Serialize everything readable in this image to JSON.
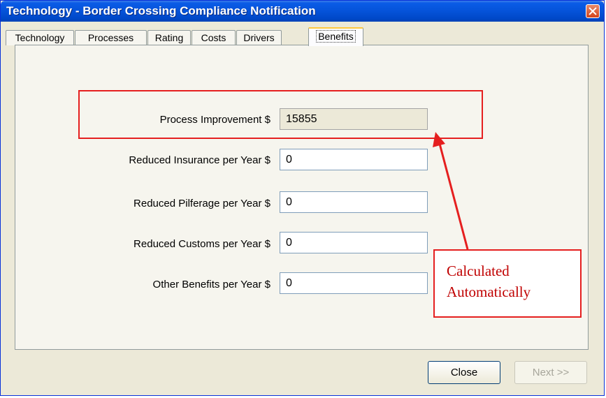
{
  "window": {
    "title": "Technology - Border Crossing Compliance Notification"
  },
  "tabs": [
    "Technology",
    "Processes",
    "Rating",
    "Costs",
    "Drivers",
    "Benefits"
  ],
  "active_tab": "Benefits",
  "fields": {
    "process_improvement": {
      "label": "Process Improvement $",
      "value": "15855"
    },
    "reduced_insurance": {
      "label": "Reduced Insurance per Year $",
      "value": "0"
    },
    "reduced_pilferage": {
      "label": "Reduced Pilferage per Year $",
      "value": "0"
    },
    "reduced_customs": {
      "label": "Reduced Customs per Year $",
      "value": "0"
    },
    "other_benefits": {
      "label": "Other Benefits per Year $",
      "value": "0"
    }
  },
  "annotation": {
    "line1": "Calculated",
    "line2": "Automatically",
    "color": "#e51f1f"
  },
  "buttons": {
    "close": "Close",
    "next": "Next >>"
  }
}
